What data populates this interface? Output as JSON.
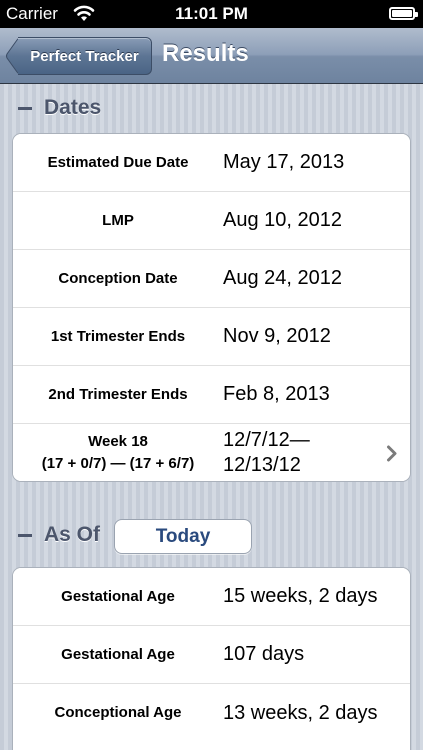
{
  "status_bar": {
    "carrier": "Carrier",
    "time": "11:01 PM"
  },
  "nav": {
    "back_label": "Perfect Tracker",
    "title": "Results"
  },
  "dates_section": {
    "header": "Dates",
    "rows": [
      {
        "label": "Estimated Due Date",
        "value": "May 17, 2013"
      },
      {
        "label": "LMP",
        "value": "Aug 10, 2012"
      },
      {
        "label": "Conception Date",
        "value": "Aug 24, 2012"
      },
      {
        "label": "1st Trimester Ends",
        "value": "Nov 9, 2012"
      },
      {
        "label": "2nd Trimester Ends",
        "value": "Feb 8, 2013"
      },
      {
        "label_line1": "Week 18",
        "label_line2": "(17 + 0/7) — (17 + 6/7)",
        "value_line1": "12/7/12—",
        "value_line2": "12/13/12"
      }
    ]
  },
  "as_of_section": {
    "header": "As Of",
    "button_label": "Today",
    "rows": [
      {
        "label": "Gestational Age",
        "value": "15 weeks, 2 days"
      },
      {
        "label": "Gestational Age",
        "value": "107 days"
      },
      {
        "label": "Conceptional Age",
        "value": "13 weeks, 2 days"
      }
    ]
  },
  "colors": {
    "nav_gradient_top": "#b0bccd",
    "nav_gradient_bottom": "#6e839f",
    "section_header": "#4c566c",
    "today_button_text": "#2a4a7e"
  },
  "icons": {
    "wifi": "wifi-icon",
    "battery": "battery-icon",
    "chevron": "chevron-right-icon"
  }
}
